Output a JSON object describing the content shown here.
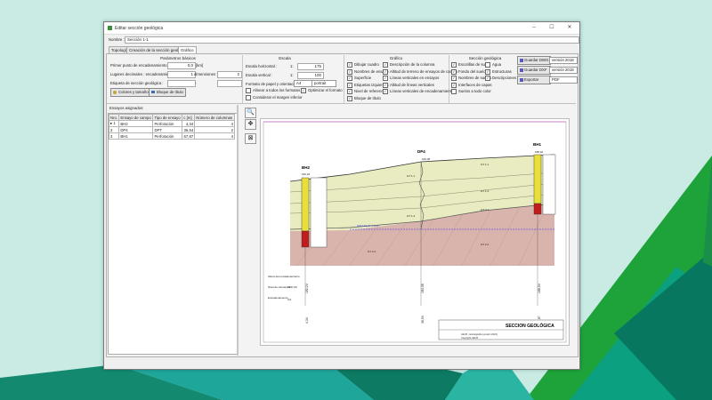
{
  "window": {
    "title": "Editar sección geológica"
  },
  "name_label": "Nombre :",
  "name_value": "Sección 1-1",
  "tabs": [
    "Topología",
    "Creación de la sección geológica",
    "Gráfico"
  ],
  "basic": {
    "title": "Parámetros básicos",
    "first_point_label": "Primer punto de encadenamiento :",
    "first_point_value": "0,0",
    "first_point_unit": "[km]",
    "decimals_label": "Lugares decimales : encadenamiento :",
    "decimals_value": "1",
    "dims_label": "dimensiones :",
    "dims_value": "2",
    "tag_label": "Etiqueta de sección geológica :",
    "tag_x": "-",
    "colors_button": "Colores y tamaños",
    "title_block_button": "Bloque de título"
  },
  "scale": {
    "title": "Escala",
    "h_label": "Escala horizontal :",
    "h_prefix": "1:",
    "h_value": "175",
    "v_label": "Escala vertical :",
    "v_prefix": "1:",
    "v_value": "100",
    "paper_label": "Formato de papel y orientación :",
    "paper_value": "A4",
    "orientation_value": "portrait",
    "align_label": "Alinear a todos los formatos",
    "optimize_label": "Optimizar el formato",
    "margin_label": "Considerar el margen inferior"
  },
  "graphics": {
    "title": "Gráfico",
    "col1": [
      "Dibujar cuadro",
      "Nombres de ensayo",
      "Superficie",
      "Etiquetas izquierdas",
      "Nivel de referencia",
      "Bloque de título"
    ],
    "col2": [
      "Descripción de la columna",
      "Altitud de terreno de ensayos de campo",
      "Líneas verticales en ensayos",
      "Altitud de líneas verticales",
      "Líneas verticales de encadenamiento"
    ]
  },
  "geo_section": {
    "title": "Sección geológica",
    "col1": [
      "Escotillas de suelo",
      "Fondo del suelo",
      "Nombres de suelos",
      "Interfaces de capas",
      "Suelos a todo color"
    ],
    "col2": [
      "Agua",
      "Estructuras",
      "Descripciones"
    ]
  },
  "export": {
    "dwg_button": "Guardar DWG",
    "dwg_version": "versión 2018",
    "dxf_button": "Guardar DXF",
    "dxf_version": "versión 2018",
    "export_button": "Exportar",
    "export_format": "PDF"
  },
  "assays": {
    "title": "Ensayos asignados:",
    "headers": [
      "Nro.",
      "Ensayo de campo",
      "Tipo de ensayo",
      "c [m]",
      "Número de columnas"
    ],
    "rows": [
      {
        "no": "1",
        "name": "BH2",
        "type": "Perforación",
        "c": "4,34",
        "cols": "4"
      },
      {
        "no": "2",
        "name": "DP4",
        "type": "DPT",
        "c": "36,54",
        "cols": "2"
      },
      {
        "no": "3",
        "name": "BH1",
        "type": "Perforación",
        "c": "67,87",
        "cols": "4"
      }
    ]
  },
  "drawing": {
    "boreholes": [
      "BH2",
      "DP4",
      "BH1"
    ],
    "elevations": [
      "182,24",
      "184,38",
      "188,04"
    ],
    "layers": [
      "GT 1.1",
      "GT 1.2",
      "GT 2.1",
      "GT 2.2"
    ],
    "layer_labels_left": [
      "GT 1.1",
      "GT 1.2",
      "GT 2.2"
    ],
    "gwl_label": "GW 179,74 m a.s.l.",
    "ref_label": "Nivel de referencia",
    "ref_value": "1997,00",
    "bottom_values": [
      "4,34",
      "36,54",
      "67,87"
    ],
    "bottom_alts": [
      "182,24",
      "184,38",
      "188,04"
    ],
    "start_label": "0,0",
    "title_block_text": "SECCION GEOLÓGICA",
    "title_block_small": [
      "GEO5 - Estratigrafía (versión 2023)",
      "Copyright GEO5"
    ],
    "legend_small": [
      "Altura del encadenamiento",
      "Nivel de referencia",
      "Encadenamiento"
    ]
  }
}
